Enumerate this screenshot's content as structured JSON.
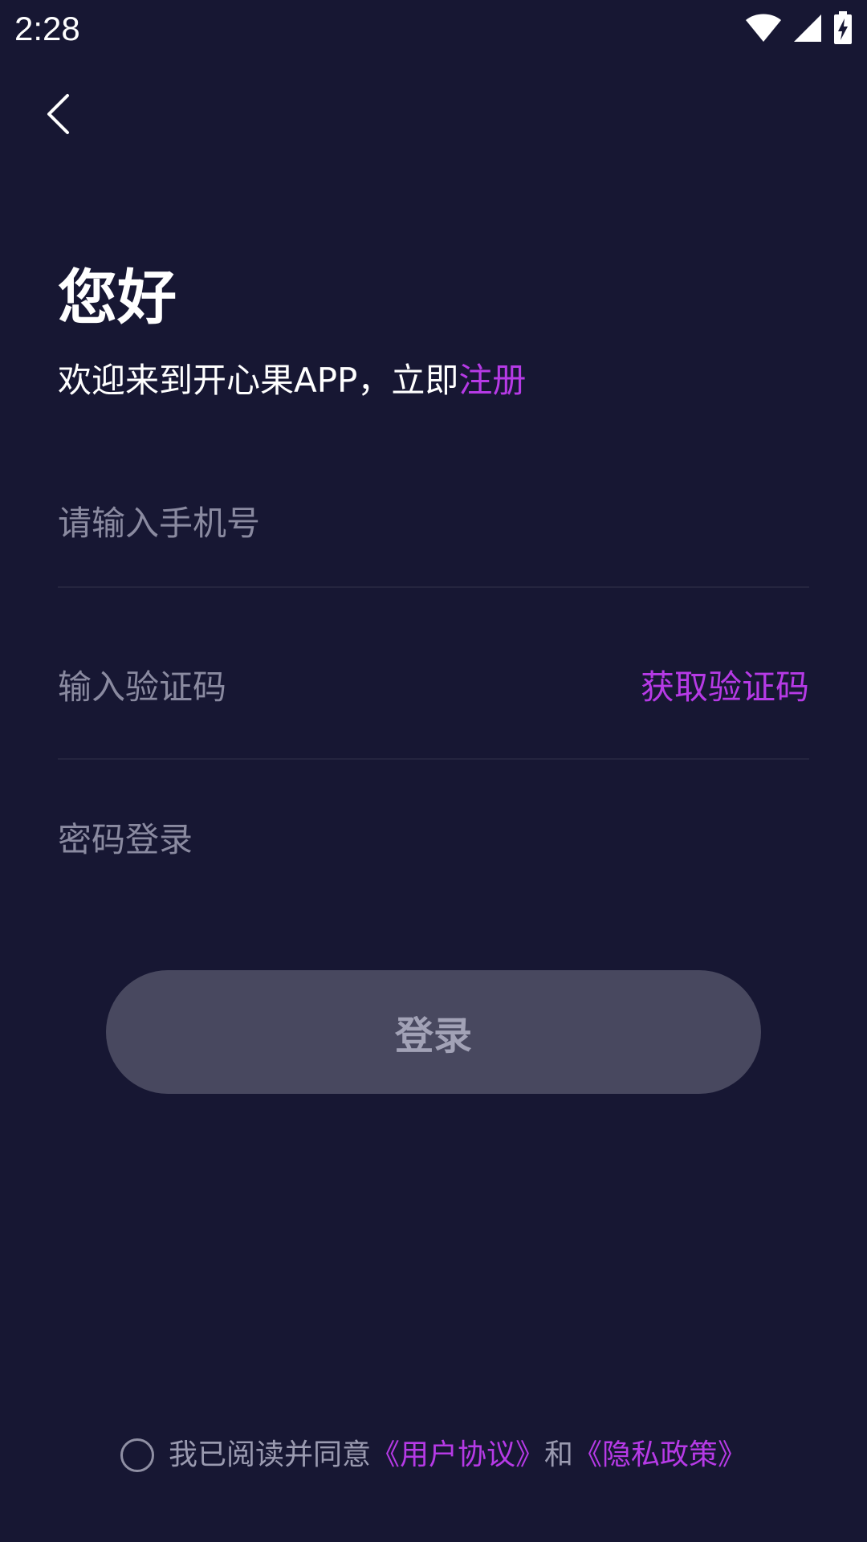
{
  "status_bar": {
    "time": "2:28",
    "icons": [
      "wifi-icon",
      "cell-signal-icon",
      "battery-charging-icon"
    ]
  },
  "header": {
    "back_icon": "chevron-left-icon"
  },
  "main": {
    "greeting": "您好",
    "welcome_prefix": "欢迎来到开心果APP，立即",
    "register_link": "注册",
    "phone_placeholder": "请输入手机号",
    "phone_value": "",
    "code_placeholder": "输入验证码",
    "code_value": "",
    "get_code_label": "获取验证码",
    "password_login_label": "密码登录",
    "login_button_label": "登录"
  },
  "agreement": {
    "prefix": "我已阅读并同意",
    "user_agreement": "《用户协议》",
    "and": "和",
    "privacy_policy": "《隐私政策》",
    "checked": false
  },
  "colors": {
    "background": "#171733",
    "accent": "#b63ae6",
    "button_disabled": "#48485f",
    "placeholder": "#8a8aa0"
  }
}
